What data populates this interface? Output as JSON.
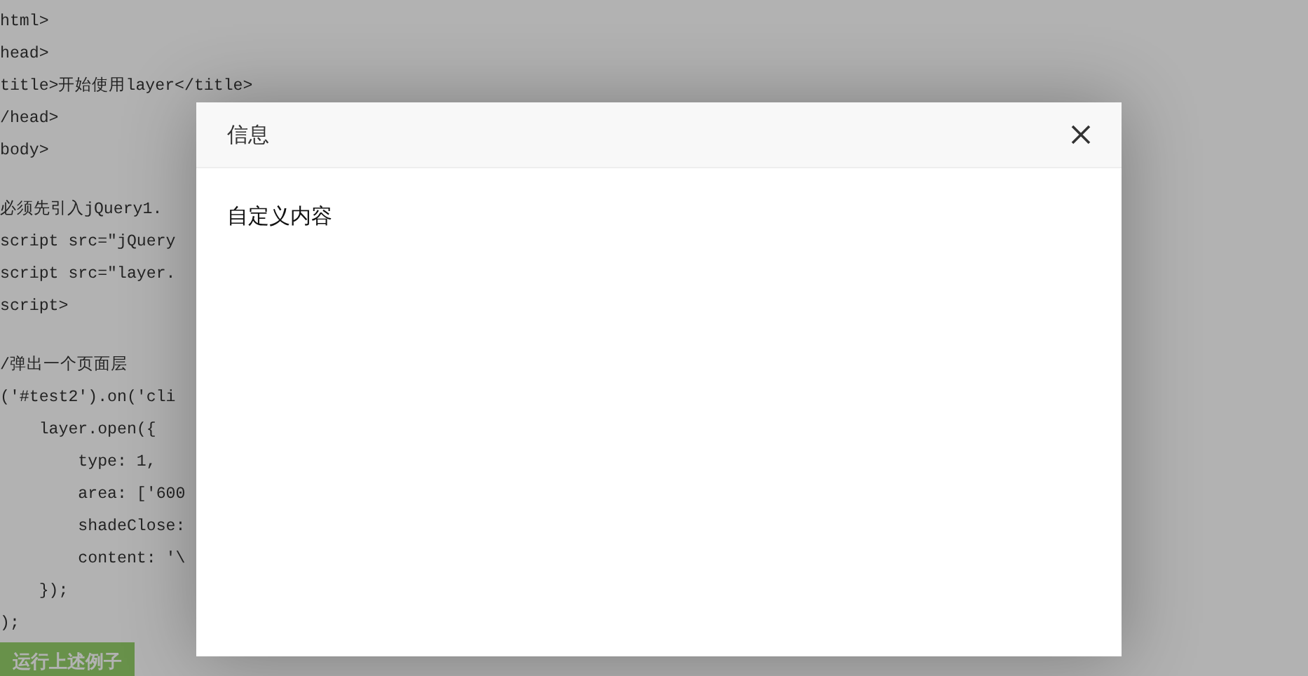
{
  "code_blocks": [
    [
      "html>",
      "head>",
      "title>开始使用layer</title>",
      "/head>",
      "body>"
    ],
    [
      "必须先引入jQuery1.",
      "script src=\"jQuery",
      "script src=\"layer.",
      "script>"
    ],
    [
      "/弹出一个页面层",
      "('#test2').on('cli",
      "    layer.open({",
      "        type: 1,",
      "        area: ['600",
      "        shadeClose:",
      "        content: '\\",
      "    });",
      ");"
    ]
  ],
  "run_button": "运行上述例子",
  "dialog": {
    "title": "信息",
    "content": "自定义内容"
  }
}
